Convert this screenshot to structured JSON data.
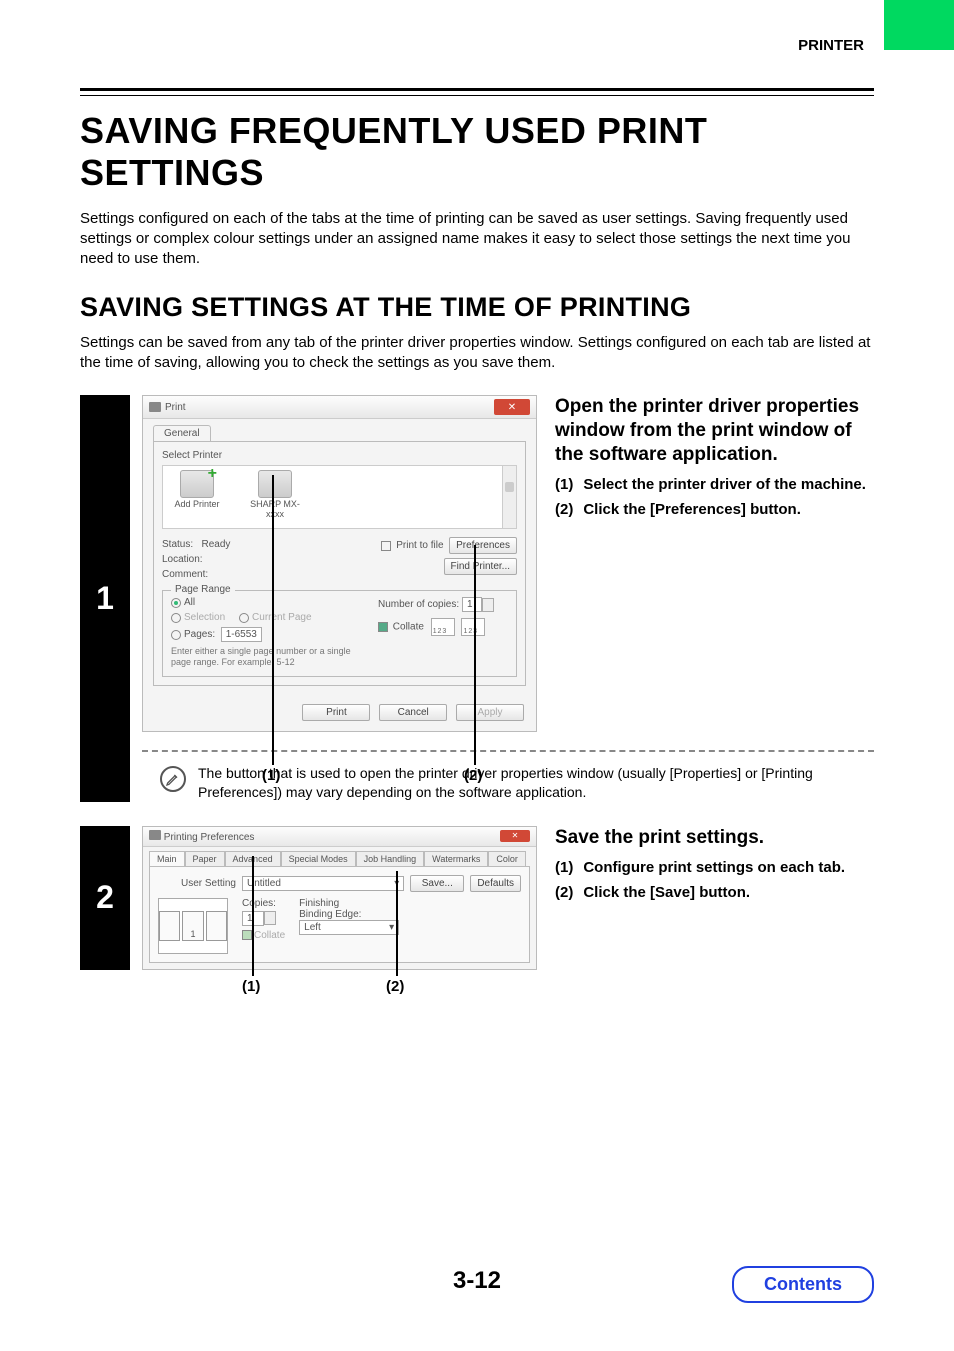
{
  "header": {
    "section": "PRINTER"
  },
  "title": "SAVING FREQUENTLY USED PRINT SETTINGS",
  "intro": "Settings configured on each of the tabs at the time of printing can be saved as user settings. Saving frequently used settings or complex colour settings under an assigned name makes it easy to select those settings the next time you need to use them.",
  "subtitle": "SAVING SETTINGS AT THE TIME OF PRINTING",
  "subintro": "Settings can be saved from any tab of the printer driver properties window. Settings configured on each tab are listed at the time of saving, allowing you to check the settings as you save them.",
  "step1": {
    "number": "1",
    "heading": "Open the printer driver properties window from the print window of the software application.",
    "items": [
      {
        "num": "(1)",
        "text": "Select the printer driver of the machine."
      },
      {
        "num": "(2)",
        "text": "Click the [Preferences] button."
      }
    ],
    "callouts": {
      "c1": "(1)",
      "c2": "(2)"
    },
    "note": "The button that is used to open the printer driver properties window (usually [Properties] or [Printing Preferences]) may vary depending on the software application."
  },
  "print_dialog": {
    "title": "Print",
    "tab": "General",
    "select_printer_label": "Select Printer",
    "printers": [
      {
        "name": "Add Printer",
        "is_add": true
      },
      {
        "name": "SHARP MX-xxxx",
        "is_add": false
      }
    ],
    "status_label": "Status:",
    "status_value": "Ready",
    "location_label": "Location:",
    "comment_label": "Comment:",
    "print_to_file": "Print to file",
    "preferences_btn": "Preferences",
    "find_printer_btn": "Find Printer...",
    "page_range_label": "Page Range",
    "all": "All",
    "selection": "Selection",
    "current_page": "Current Page",
    "pages": "Pages:",
    "pages_value": "1-6553",
    "pages_hint": "Enter either a single page number or a single page range.  For example, 5-12",
    "copies_label": "Number of copies:",
    "copies_value": "1",
    "collate": "Collate",
    "buttons": {
      "print": "Print",
      "cancel": "Cancel",
      "apply": "Apply"
    }
  },
  "step2": {
    "number": "2",
    "heading": "Save the print settings.",
    "items": [
      {
        "num": "(1)",
        "text": "Configure print settings on each tab."
      },
      {
        "num": "(2)",
        "text": "Click the [Save] button."
      }
    ],
    "callouts": {
      "c1": "(1)",
      "c2": "(2)"
    }
  },
  "prefs_dialog": {
    "title": "Printing Preferences",
    "tabs": [
      "Main",
      "Paper",
      "Advanced",
      "Special Modes",
      "Job Handling",
      "Watermarks",
      "Color"
    ],
    "user_setting_label": "User Setting",
    "user_setting_value": "Untitled",
    "save_btn": "Save...",
    "defaults_btn": "Defaults",
    "copies_label": "Copies:",
    "copies_value": "1",
    "collate": "Collate",
    "finishing_label": "Finishing",
    "binding_label": "Binding Edge:",
    "binding_value": "Left",
    "preview_page": "1"
  },
  "page_number": "3-12",
  "contents": "Contents"
}
